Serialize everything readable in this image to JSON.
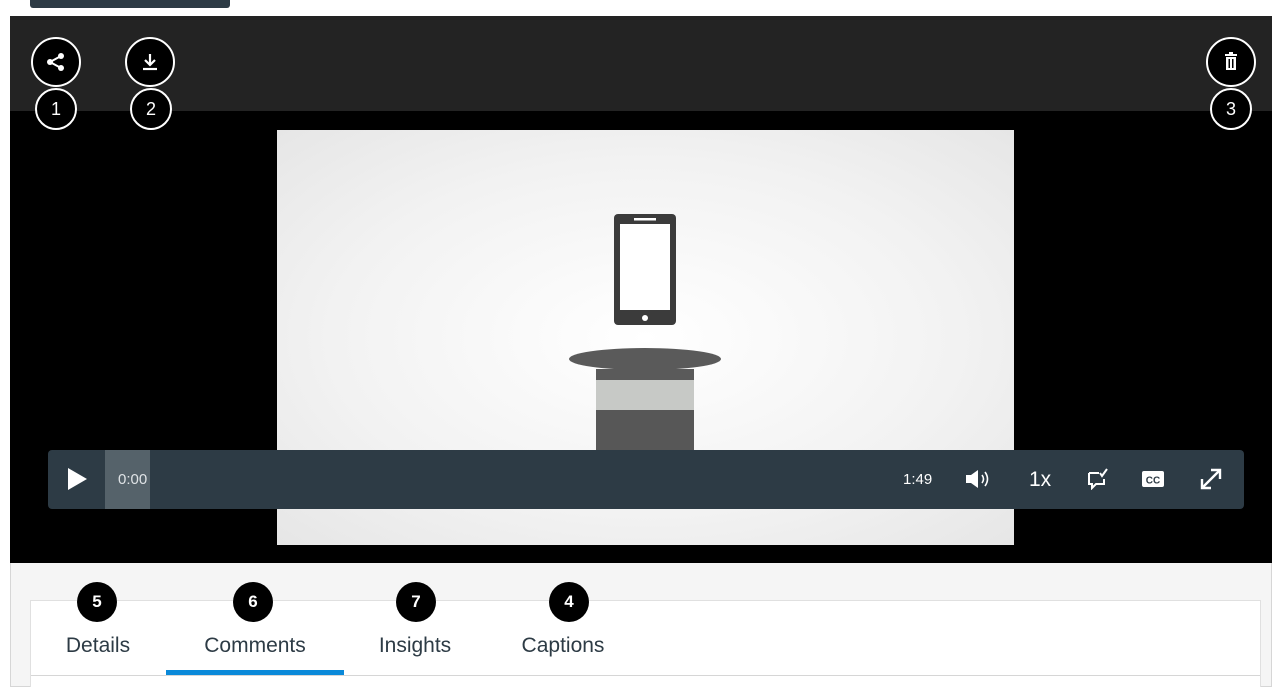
{
  "toolbar": {
    "share_badge": "1",
    "download_badge": "2",
    "delete_badge": "3"
  },
  "player": {
    "current_time": "0:00",
    "duration": "1:49",
    "speed": "1x",
    "progress_fraction": 0.0
  },
  "tabs": [
    {
      "label": "Details",
      "badge": "5"
    },
    {
      "label": "Comments",
      "badge": "6",
      "selected": true
    },
    {
      "label": "Insights",
      "badge": "7"
    },
    {
      "label": "Captions",
      "badge": "4"
    }
  ],
  "icons": {
    "share": "share-icon",
    "download": "download-icon",
    "delete": "trash-icon",
    "play": "play-icon",
    "volume": "volume-icon",
    "quiz": "quiz-icon",
    "captions": "closed-captions-icon",
    "fullscreen": "fullscreen-icon"
  },
  "colors": {
    "control_bar": "#2d3b45",
    "active_tab": "#0a89d9"
  }
}
